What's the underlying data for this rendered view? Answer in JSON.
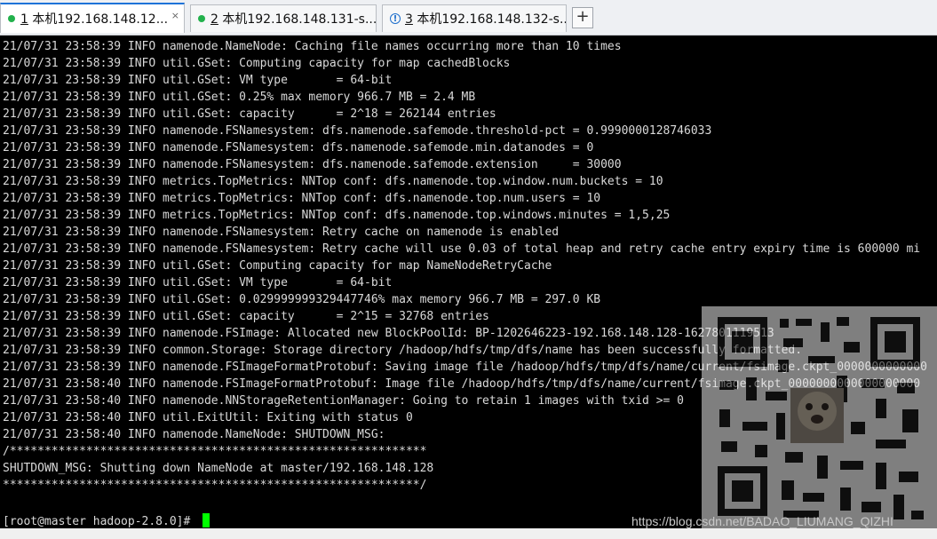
{
  "tabs": [
    {
      "num": "1",
      "title": " 本机192.168.148.12...",
      "status": "connected",
      "status_color": "#22b14c",
      "active": true
    },
    {
      "num": "2",
      "title": " 本机192.168.148.131-s...",
      "status": "connected",
      "status_color": "#22b14c",
      "active": false
    },
    {
      "num": "3",
      "title": " 本机192.168.148.132-s...",
      "status": "warning",
      "status_color": "#1e6fcc",
      "active": false
    }
  ],
  "close_glyph": "×",
  "warn_glyph": "!",
  "add_tab_label": "+",
  "terminal": {
    "lines": [
      "21/07/31 23:58:39 INFO namenode.NameNode: Caching file names occurring more than 10 times",
      "21/07/31 23:58:39 INFO util.GSet: Computing capacity for map cachedBlocks",
      "21/07/31 23:58:39 INFO util.GSet: VM type       = 64-bit",
      "21/07/31 23:58:39 INFO util.GSet: 0.25% max memory 966.7 MB = 2.4 MB",
      "21/07/31 23:58:39 INFO util.GSet: capacity      = 2^18 = 262144 entries",
      "21/07/31 23:58:39 INFO namenode.FSNamesystem: dfs.namenode.safemode.threshold-pct = 0.9990000128746033",
      "21/07/31 23:58:39 INFO namenode.FSNamesystem: dfs.namenode.safemode.min.datanodes = 0",
      "21/07/31 23:58:39 INFO namenode.FSNamesystem: dfs.namenode.safemode.extension     = 30000",
      "21/07/31 23:58:39 INFO metrics.TopMetrics: NNTop conf: dfs.namenode.top.window.num.buckets = 10",
      "21/07/31 23:58:39 INFO metrics.TopMetrics: NNTop conf: dfs.namenode.top.num.users = 10",
      "21/07/31 23:58:39 INFO metrics.TopMetrics: NNTop conf: dfs.namenode.top.windows.minutes = 1,5,25",
      "21/07/31 23:58:39 INFO namenode.FSNamesystem: Retry cache on namenode is enabled",
      "21/07/31 23:58:39 INFO namenode.FSNamesystem: Retry cache will use 0.03 of total heap and retry cache entry expiry time is 600000 mi",
      "21/07/31 23:58:39 INFO util.GSet: Computing capacity for map NameNodeRetryCache",
      "21/07/31 23:58:39 INFO util.GSet: VM type       = 64-bit",
      "21/07/31 23:58:39 INFO util.GSet: 0.029999999329447746% max memory 966.7 MB = 297.0 KB",
      "21/07/31 23:58:39 INFO util.GSet: capacity      = 2^15 = 32768 entries",
      "21/07/31 23:58:39 INFO namenode.FSImage: Allocated new BlockPoolId: BP-1202646223-192.168.148.128-1627801119513",
      "21/07/31 23:58:39 INFO common.Storage: Storage directory /hadoop/hdfs/tmp/dfs/name has been successfully formatted.",
      "21/07/31 23:58:39 INFO namenode.FSImageFormatProtobuf: Saving image file /hadoop/hdfs/tmp/dfs/name/current/fsimage.ckpt_0000000000000",
      "21/07/31 23:58:40 INFO namenode.FSImageFormatProtobuf: Image file /hadoop/hdfs/tmp/dfs/name/current/fsimage.ckpt_0000000000000000000",
      "21/07/31 23:58:40 INFO namenode.NNStorageRetentionManager: Going to retain 1 images with txid >= 0",
      "21/07/31 23:58:40 INFO util.ExitUtil: Exiting with status 0",
      "21/07/31 23:58:40 INFO namenode.NameNode: SHUTDOWN_MSG:",
      "/************************************************************",
      "SHUTDOWN_MSG: Shutting down NameNode at master/192.168.148.128",
      "************************************************************/",
      "",
      "[root@master hadoop-2.8.0]# "
    ],
    "text_color": "#d9d9d9",
    "background": "#000000",
    "cursor_color": "#00ff00"
  },
  "watermark": "https://blog.csdn.net/BADAO_LIUMANG_QIZHI"
}
